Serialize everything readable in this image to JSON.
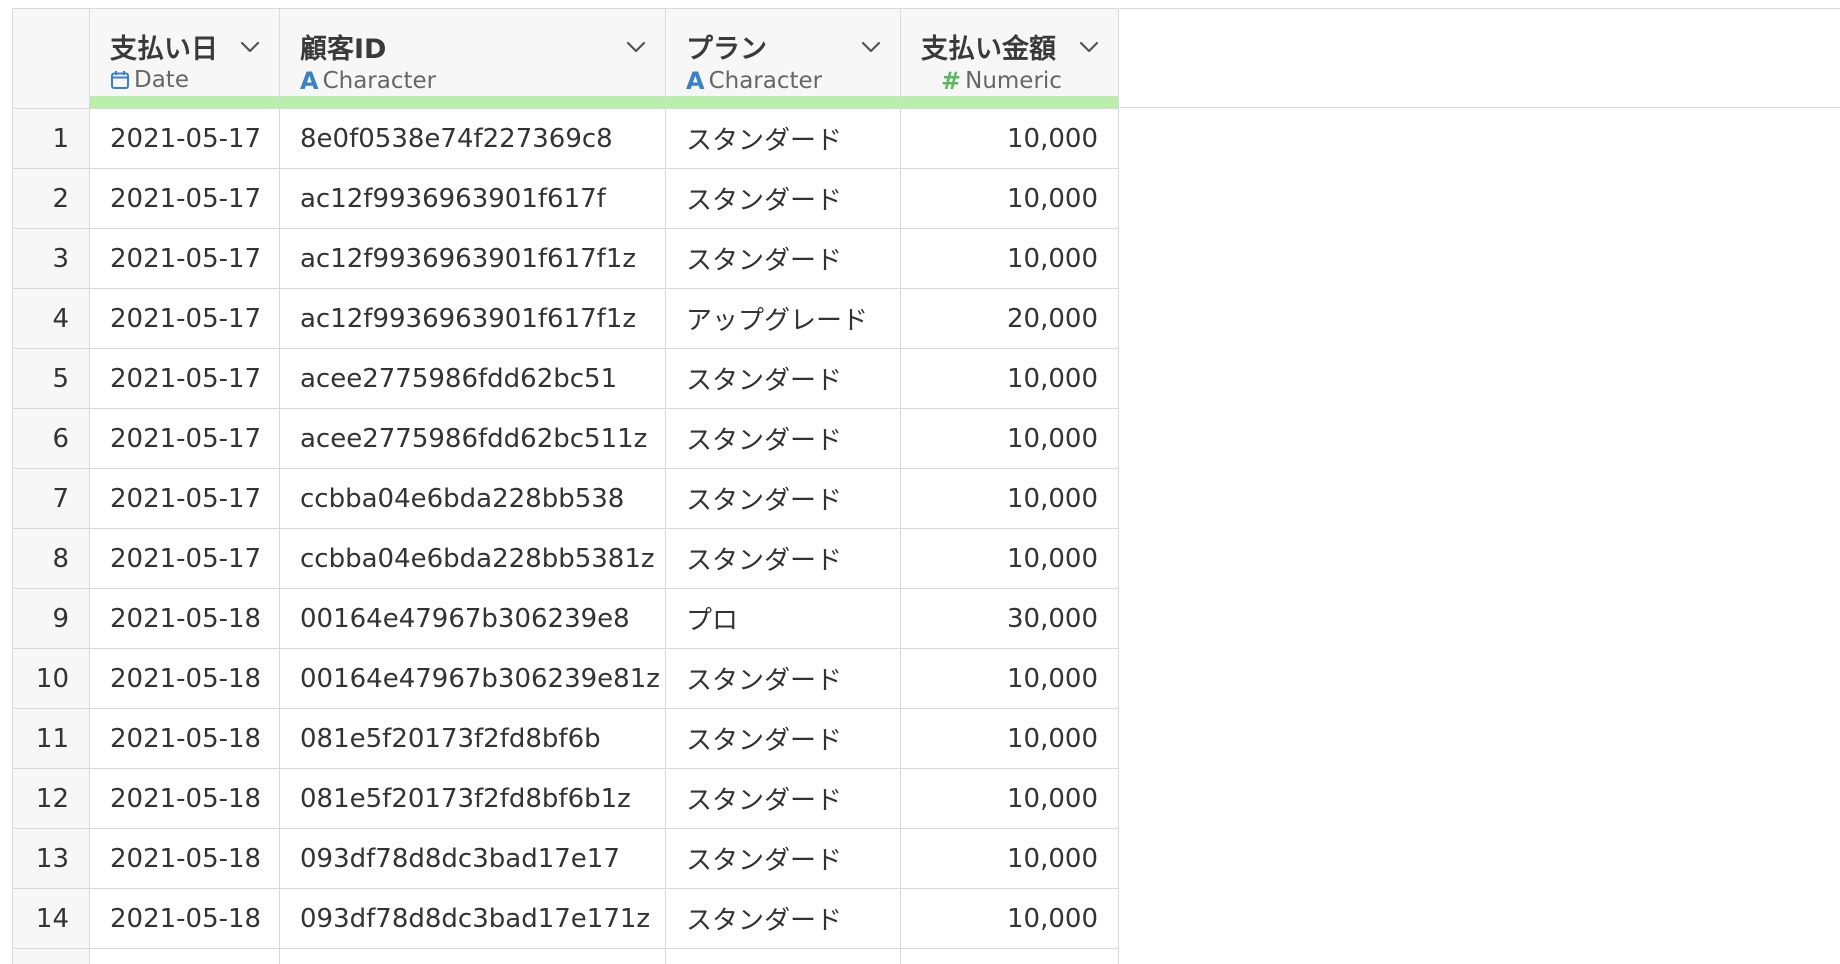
{
  "columns": [
    {
      "title": "支払い日",
      "type_label": "Date",
      "type_icon": "calendar-icon"
    },
    {
      "title": "顧客ID",
      "type_label": "Character",
      "type_icon": "character-type-icon"
    },
    {
      "title": "プラン",
      "type_label": "Character",
      "type_icon": "character-type-icon"
    },
    {
      "title": "支払い金額",
      "type_label": "Numeric",
      "type_icon": "numeric-type-icon"
    }
  ],
  "colors": {
    "header_bg": "#f7f7f7",
    "border": "#d9d9d9",
    "quality_bar": "#b9efaa",
    "date_icon": "#3b82c4",
    "char_icon": "#3b82c4",
    "numeric_icon": "#5cb85c"
  },
  "rows": [
    {
      "num": "1",
      "date": "2021-05-17",
      "id": "8e0f0538e74f227369c8",
      "plan": "スタンダード",
      "amount": "10,000"
    },
    {
      "num": "2",
      "date": "2021-05-17",
      "id": "ac12f9936963901f617f",
      "plan": "スタンダード",
      "amount": "10,000"
    },
    {
      "num": "3",
      "date": "2021-05-17",
      "id": "ac12f9936963901f617f1z",
      "plan": "スタンダード",
      "amount": "10,000"
    },
    {
      "num": "4",
      "date": "2021-05-17",
      "id": "ac12f9936963901f617f1z",
      "plan": "アップグレード",
      "amount": "20,000"
    },
    {
      "num": "5",
      "date": "2021-05-17",
      "id": "acee2775986fdd62bc51",
      "plan": "スタンダード",
      "amount": "10,000"
    },
    {
      "num": "6",
      "date": "2021-05-17",
      "id": "acee2775986fdd62bc511z",
      "plan": "スタンダード",
      "amount": "10,000"
    },
    {
      "num": "7",
      "date": "2021-05-17",
      "id": "ccbba04e6bda228bb538",
      "plan": "スタンダード",
      "amount": "10,000"
    },
    {
      "num": "8",
      "date": "2021-05-17",
      "id": "ccbba04e6bda228bb5381z",
      "plan": "スタンダード",
      "amount": "10,000"
    },
    {
      "num": "9",
      "date": "2021-05-18",
      "id": "00164e47967b306239e8",
      "plan": "プロ",
      "amount": "30,000"
    },
    {
      "num": "10",
      "date": "2021-05-18",
      "id": "00164e47967b306239e81z",
      "plan": "スタンダード",
      "amount": "10,000"
    },
    {
      "num": "11",
      "date": "2021-05-18",
      "id": "081e5f20173f2fd8bf6b",
      "plan": "スタンダード",
      "amount": "10,000"
    },
    {
      "num": "12",
      "date": "2021-05-18",
      "id": "081e5f20173f2fd8bf6b1z",
      "plan": "スタンダード",
      "amount": "10,000"
    },
    {
      "num": "13",
      "date": "2021-05-18",
      "id": "093df78d8dc3bad17e17",
      "plan": "スタンダード",
      "amount": "10,000"
    },
    {
      "num": "14",
      "date": "2021-05-18",
      "id": "093df78d8dc3bad17e171z",
      "plan": "スタンダード",
      "amount": "10,000"
    }
  ]
}
